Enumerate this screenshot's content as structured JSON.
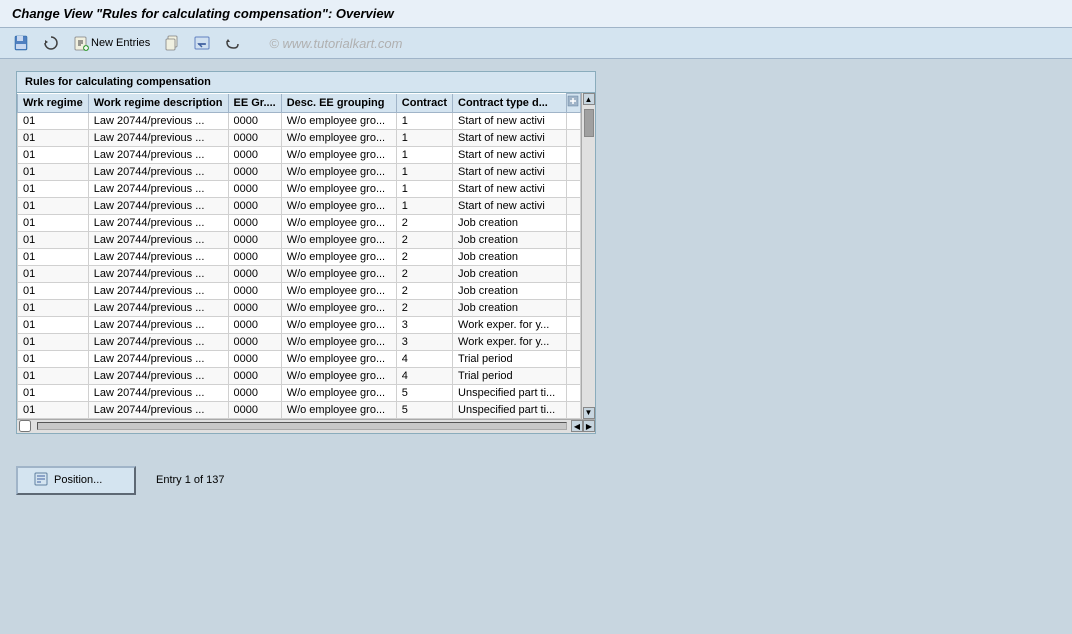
{
  "title": "Change View \"Rules for calculating compensation\": Overview",
  "toolbar": {
    "new_entries_label": "New Entries",
    "watermark": "© www.tutorialkart.com"
  },
  "table": {
    "title": "Rules for calculating compensation",
    "columns": [
      {
        "key": "wrk_regime",
        "label": "Wrk regime"
      },
      {
        "key": "work_regime_description",
        "label": "Work regime description"
      },
      {
        "key": "ee_gr",
        "label": "EE Gr...."
      },
      {
        "key": "desc_ee_grouping",
        "label": "Desc. EE grouping"
      },
      {
        "key": "contract",
        "label": "Contract"
      },
      {
        "key": "contract_type_d",
        "label": "Contract type d..."
      }
    ],
    "rows": [
      {
        "wrk_regime": "01",
        "work_regime_description": "Law 20744/previous ...",
        "ee_gr": "0000",
        "desc_ee_grouping": "W/o employee gro...",
        "contract": "1",
        "contract_type_d": "Start of new activi"
      },
      {
        "wrk_regime": "01",
        "work_regime_description": "Law 20744/previous ...",
        "ee_gr": "0000",
        "desc_ee_grouping": "W/o employee gro...",
        "contract": "1",
        "contract_type_d": "Start of new activi"
      },
      {
        "wrk_regime": "01",
        "work_regime_description": "Law 20744/previous ...",
        "ee_gr": "0000",
        "desc_ee_grouping": "W/o employee gro...",
        "contract": "1",
        "contract_type_d": "Start of new activi"
      },
      {
        "wrk_regime": "01",
        "work_regime_description": "Law 20744/previous ...",
        "ee_gr": "0000",
        "desc_ee_grouping": "W/o employee gro...",
        "contract": "1",
        "contract_type_d": "Start of new activi"
      },
      {
        "wrk_regime": "01",
        "work_regime_description": "Law 20744/previous ...",
        "ee_gr": "0000",
        "desc_ee_grouping": "W/o employee gro...",
        "contract": "1",
        "contract_type_d": "Start of new activi"
      },
      {
        "wrk_regime": "01",
        "work_regime_description": "Law 20744/previous ...",
        "ee_gr": "0000",
        "desc_ee_grouping": "W/o employee gro...",
        "contract": "1",
        "contract_type_d": "Start of new activi"
      },
      {
        "wrk_regime": "01",
        "work_regime_description": "Law 20744/previous ...",
        "ee_gr": "0000",
        "desc_ee_grouping": "W/o employee gro...",
        "contract": "2",
        "contract_type_d": "Job creation"
      },
      {
        "wrk_regime": "01",
        "work_regime_description": "Law 20744/previous ...",
        "ee_gr": "0000",
        "desc_ee_grouping": "W/o employee gro...",
        "contract": "2",
        "contract_type_d": "Job creation"
      },
      {
        "wrk_regime": "01",
        "work_regime_description": "Law 20744/previous ...",
        "ee_gr": "0000",
        "desc_ee_grouping": "W/o employee gro...",
        "contract": "2",
        "contract_type_d": "Job creation"
      },
      {
        "wrk_regime": "01",
        "work_regime_description": "Law 20744/previous ...",
        "ee_gr": "0000",
        "desc_ee_grouping": "W/o employee gro...",
        "contract": "2",
        "contract_type_d": "Job creation"
      },
      {
        "wrk_regime": "01",
        "work_regime_description": "Law 20744/previous ...",
        "ee_gr": "0000",
        "desc_ee_grouping": "W/o employee gro...",
        "contract": "2",
        "contract_type_d": "Job creation"
      },
      {
        "wrk_regime": "01",
        "work_regime_description": "Law 20744/previous ...",
        "ee_gr": "0000",
        "desc_ee_grouping": "W/o employee gro...",
        "contract": "2",
        "contract_type_d": "Job creation"
      },
      {
        "wrk_regime": "01",
        "work_regime_description": "Law 20744/previous ...",
        "ee_gr": "0000",
        "desc_ee_grouping": "W/o employee gro...",
        "contract": "3",
        "contract_type_d": "Work exper. for y..."
      },
      {
        "wrk_regime": "01",
        "work_regime_description": "Law 20744/previous ...",
        "ee_gr": "0000",
        "desc_ee_grouping": "W/o employee gro...",
        "contract": "3",
        "contract_type_d": "Work exper. for y..."
      },
      {
        "wrk_regime": "01",
        "work_regime_description": "Law 20744/previous ...",
        "ee_gr": "0000",
        "desc_ee_grouping": "W/o employee gro...",
        "contract": "4",
        "contract_type_d": "Trial period"
      },
      {
        "wrk_regime": "01",
        "work_regime_description": "Law 20744/previous ...",
        "ee_gr": "0000",
        "desc_ee_grouping": "W/o employee gro...",
        "contract": "4",
        "contract_type_d": "Trial period"
      },
      {
        "wrk_regime": "01",
        "work_regime_description": "Law 20744/previous ...",
        "ee_gr": "0000",
        "desc_ee_grouping": "W/o employee gro...",
        "contract": "5",
        "contract_type_d": "Unspecified part ti..."
      },
      {
        "wrk_regime": "01",
        "work_regime_description": "Law 20744/previous ...",
        "ee_gr": "0000",
        "desc_ee_grouping": "W/o employee gro...",
        "contract": "5",
        "contract_type_d": "Unspecified part ti..."
      }
    ]
  },
  "bottom": {
    "position_label": "Position...",
    "entry_info": "Entry 1 of 137"
  },
  "icons": {
    "save_icon": "💾",
    "new_entries_icon": "📄",
    "copy_icon": "📋",
    "undo_icon": "↩",
    "position_icon": "📍"
  }
}
